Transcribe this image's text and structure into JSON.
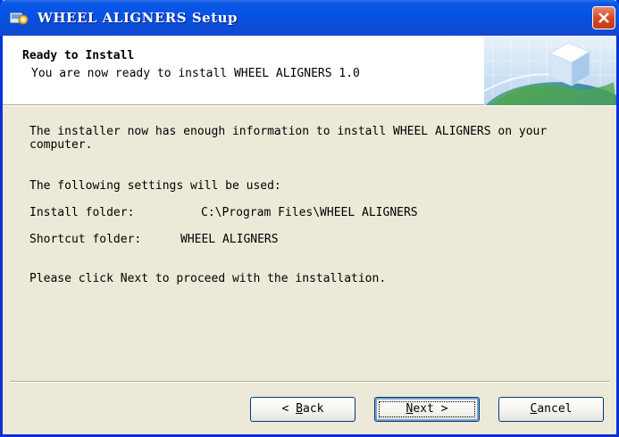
{
  "window": {
    "title": "WHEEL ALIGNERS Setup"
  },
  "header": {
    "title": "Ready to Install",
    "subtitle": "You are now ready to install WHEEL ALIGNERS 1.0"
  },
  "body": {
    "intro": "The installer now has enough information to install WHEEL ALIGNERS on your computer.",
    "settings_intro": "The following settings will be used:",
    "install_folder_label": "Install folder:",
    "install_folder_value": "C:\\Program Files\\WHEEL ALIGNERS",
    "shortcut_folder_label": "Shortcut folder:",
    "shortcut_folder_value": "WHEEL ALIGNERS",
    "proceed": "Please click Next to proceed with the installation."
  },
  "buttons": {
    "back": {
      "prefix": "< ",
      "mnemonic": "B",
      "rest": "ack"
    },
    "next": {
      "mnemonic": "N",
      "rest": "ext >"
    },
    "cancel": {
      "mnemonic": "C",
      "rest": "ancel"
    }
  },
  "icons": {
    "app": "installer-app-icon",
    "close": "close-icon",
    "header_graphic": "globe-cube-graphic"
  },
  "colors": {
    "titlebar": "#0552e8",
    "close": "#d84a28",
    "dialog_bg": "#ece9d8"
  }
}
